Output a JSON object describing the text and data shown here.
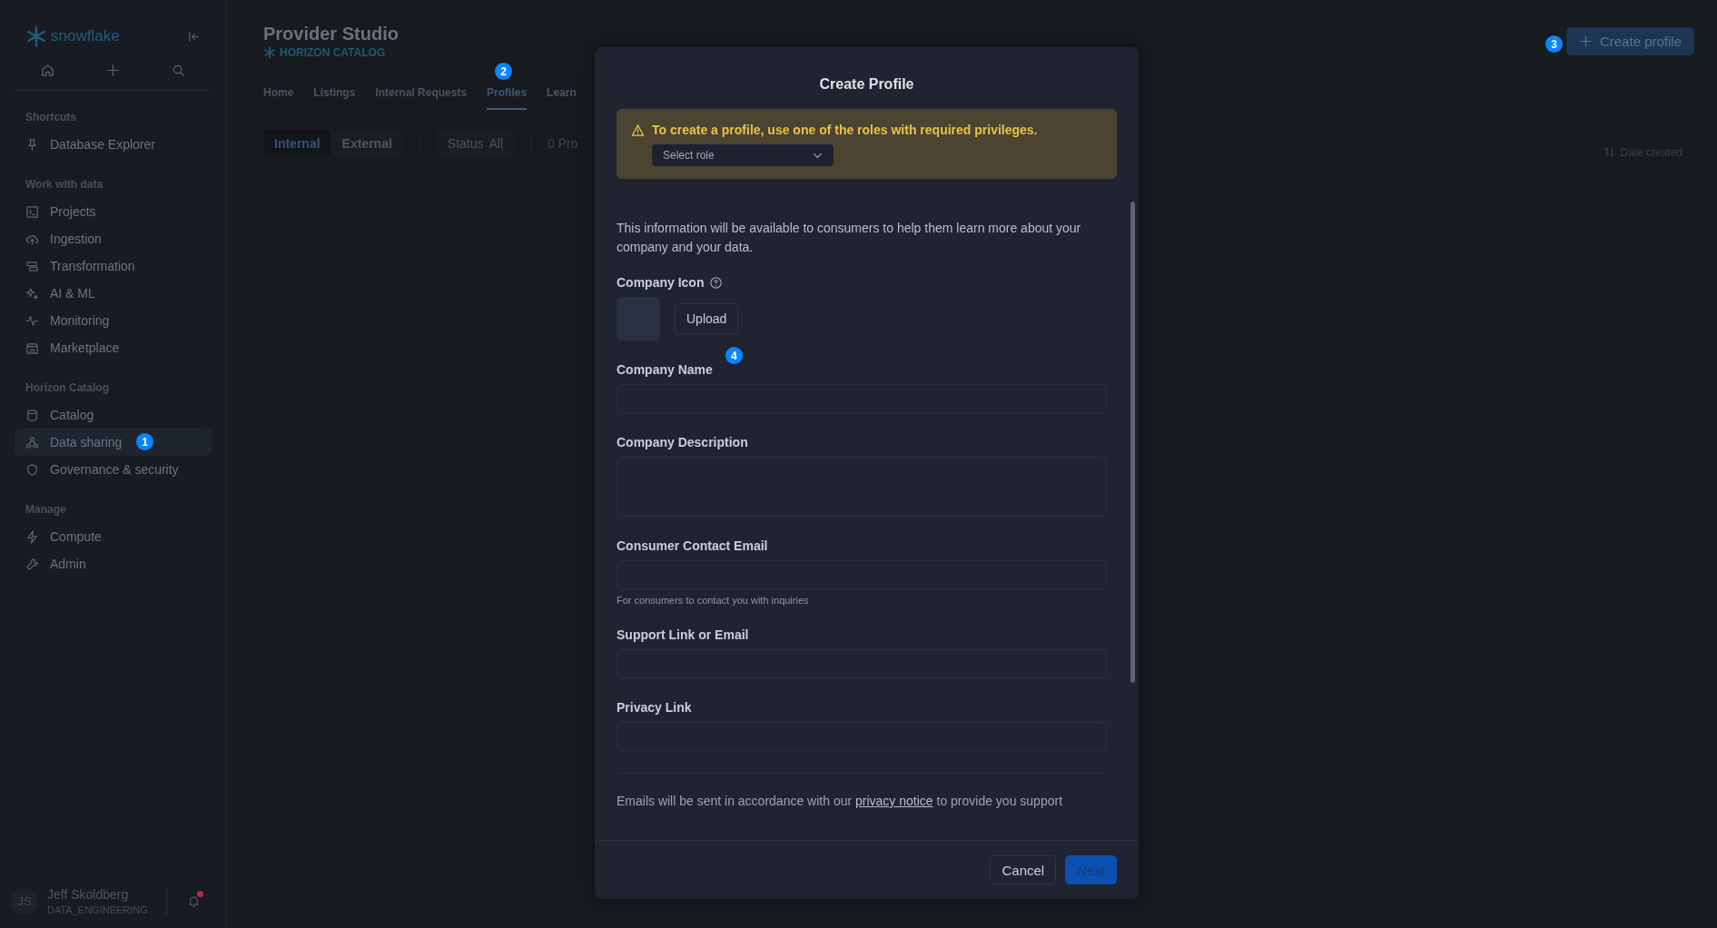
{
  "sidebar": {
    "logo": "snowflake",
    "sections": [
      {
        "title": "Shortcuts",
        "items": [
          {
            "label": "Database Explorer",
            "selected": false
          }
        ]
      },
      {
        "title": "Work with data",
        "items": [
          {
            "label": "Projects",
            "selected": false
          },
          {
            "label": "Ingestion",
            "selected": false
          },
          {
            "label": "Transformation",
            "selected": false
          },
          {
            "label": "AI & ML",
            "selected": false
          },
          {
            "label": "Monitoring",
            "selected": false
          },
          {
            "label": "Marketplace",
            "selected": false
          }
        ]
      },
      {
        "title": "Horizon Catalog",
        "items": [
          {
            "label": "Catalog",
            "selected": false
          },
          {
            "label": "Data sharing",
            "selected": true,
            "marker": "1"
          },
          {
            "label": "Governance & security",
            "selected": false
          }
        ]
      },
      {
        "title": "Manage",
        "items": [
          {
            "label": "Compute",
            "selected": false
          },
          {
            "label": "Admin",
            "selected": false
          }
        ]
      }
    ],
    "user": {
      "initials": "JS",
      "name": "Jeff Skoldberg",
      "role": "DATA_ENGINEERING",
      "notification": true
    }
  },
  "header": {
    "title": "Provider Studio",
    "subtitle": "HORIZON CATALOG",
    "create_button": {
      "label": "Create profile",
      "marker": "3"
    }
  },
  "tabs": [
    {
      "label": "Home",
      "selected": false
    },
    {
      "label": "Listings",
      "selected": false
    },
    {
      "label": "Internal Requests",
      "selected": false
    },
    {
      "label": "Profiles",
      "selected": true,
      "marker": "2"
    },
    {
      "label": "Learn",
      "selected": false
    }
  ],
  "segments": [
    {
      "label": "Internal",
      "selected": true
    },
    {
      "label": "External",
      "selected": false
    }
  ],
  "status_filter": {
    "label": "Status",
    "value": "All"
  },
  "count": "0 Pro",
  "sort": {
    "label": "Date created"
  },
  "dialog": {
    "title": "Create Profile",
    "warning": {
      "text": "To create a profile, use one of the roles with required privileges.",
      "select": {
        "placeholder": "Select role"
      }
    },
    "intro": "This information will be available to consumers to help them learn more about your company and your data.",
    "icon_field": {
      "label": "Company Icon",
      "button": "Upload"
    },
    "fields": [
      {
        "label": "Company Name",
        "kind": "input",
        "marker": "4"
      },
      {
        "label": "Company Description",
        "kind": "textarea"
      },
      {
        "label": "Consumer Contact Email",
        "kind": "input",
        "help": "For consumers to contact you with inquiries"
      },
      {
        "label": "Support Link or Email",
        "kind": "input"
      },
      {
        "label": "Privacy Link",
        "kind": "input"
      }
    ],
    "notice": {
      "before": "Emails will be sent in accordance with our ",
      "link": "privacy notice",
      "after": " to provide you support"
    },
    "buttons": [
      {
        "label": "Cancel",
        "kind": "secondary"
      },
      {
        "label": "Next",
        "kind": "primary"
      }
    ]
  }
}
